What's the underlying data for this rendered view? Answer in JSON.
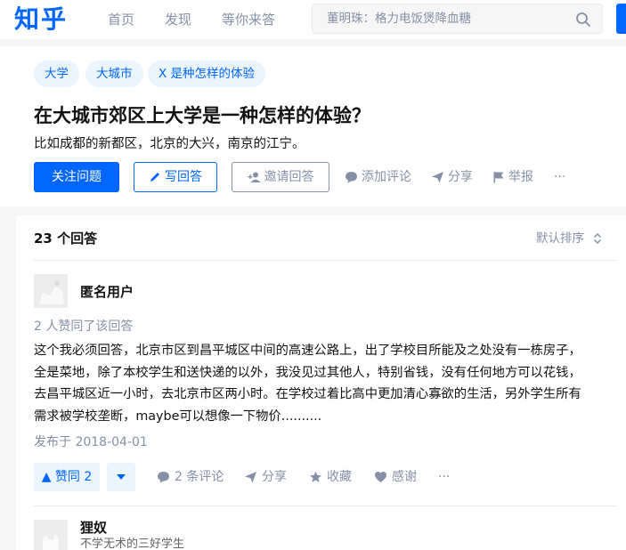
{
  "header": {
    "logo": "知乎",
    "nav": [
      "首页",
      "发现",
      "等你来答"
    ],
    "search_placeholder": "董明珠：格力电饭煲降血糖"
  },
  "question": {
    "tags": [
      "大学",
      "大城市",
      "X 是种怎样的体验"
    ],
    "title": "在大城市郊区上大学是一种怎样的体验？",
    "detail": "比如成都的新都区，北京的大兴，南京的江宁。",
    "follow_label": "关注问题",
    "write_label": "写回答",
    "invite_label": "邀请回答",
    "comment_label": "添加评论",
    "share_label": "分享",
    "report_label": "举报",
    "more_label": "···"
  },
  "answers": {
    "count_label": "23 个回答",
    "sort_label": "默认排序",
    "items": [
      {
        "author": "匿名用户",
        "votes_text": "2 人赞同了该回答",
        "content_lines": [
          "这个我必须回答，北京市区到昌平城区中间的高速公路上，出了学校目所能及之处没有一栋房子，",
          "全是菜地，除了本校学生和送快递的以外，我没见过其他人，特别省钱，没有任何地方可以花钱，",
          "去昌平城区近一小时，去北京市区两小时。在学校过着比高中更加清心寡欲的生活，另外学生所有",
          "需求被学校垄断，maybe可以想像一下物价.........."
        ],
        "published": "发布于 2018-04-01",
        "upvote_label": "▲ 赞同 2",
        "comments_label": "2 条评论",
        "share_label": "分享",
        "collect_label": "收藏",
        "thanks_label": "感谢",
        "more_label": "···"
      },
      {
        "author": "狸奴",
        "headline": "不学无术的三好学生"
      }
    ]
  },
  "colors": {
    "brand": "#0066ff",
    "muted": "#8590a6",
    "tag_bg": "#ebf5ff"
  }
}
